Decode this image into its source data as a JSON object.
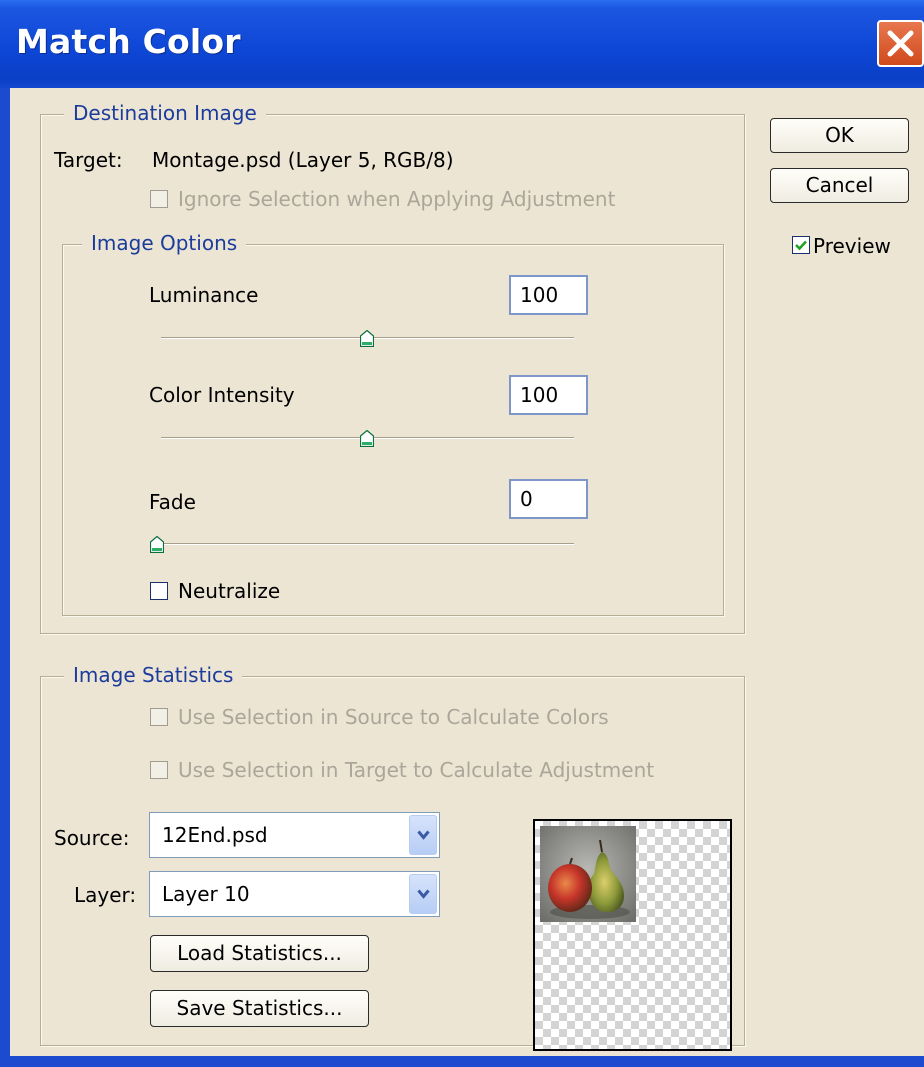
{
  "window": {
    "title": "Match Color"
  },
  "destination": {
    "legend": "Destination Image",
    "target_label": "Target:",
    "target_value": "Montage.psd (Layer 5, RGB/8)",
    "ignore_selection_label": "Ignore Selection when Applying Adjustment",
    "ignore_selection_checked": false,
    "ignore_selection_enabled": false
  },
  "image_options": {
    "legend": "Image Options",
    "luminance": {
      "label": "Luminance",
      "value": "100",
      "slider_fraction": 0.5
    },
    "color_intensity": {
      "label": "Color Intensity",
      "value": "100",
      "slider_fraction": 0.5
    },
    "fade": {
      "label": "Fade",
      "value": "0",
      "slider_fraction": 0.0
    },
    "neutralize": {
      "label": "Neutralize",
      "checked": false
    }
  },
  "image_statistics": {
    "legend": "Image Statistics",
    "use_source_selection_label": "Use Selection in Source to Calculate Colors",
    "use_target_selection_label": "Use Selection in Target to Calculate Adjustment",
    "source_label": "Source:",
    "source_value": "12End.psd",
    "layer_label": "Layer:",
    "layer_value": "Layer 10",
    "load_button": "Load Statistics...",
    "save_button": "Save Statistics..."
  },
  "buttons": {
    "ok": "OK",
    "cancel": "Cancel"
  },
  "preview": {
    "label": "Preview",
    "checked": true
  },
  "colors": {
    "titlebar": "#0e47d6",
    "dialog_bg": "#ece5d4",
    "legend_text": "#1c3c9c",
    "disabled_text": "#aca69a"
  }
}
